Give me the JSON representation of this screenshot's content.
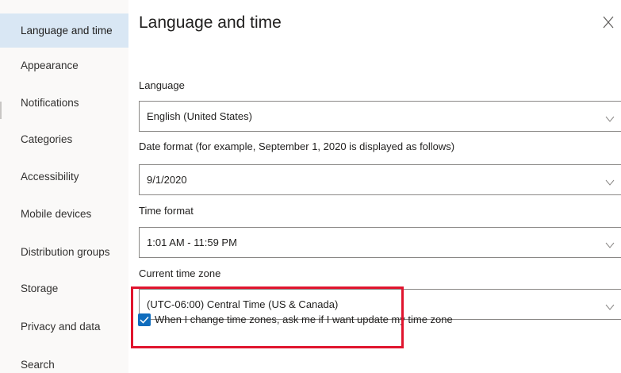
{
  "sidebar": {
    "items": [
      {
        "label": "Language and time",
        "active": true
      },
      {
        "label": "Appearance",
        "active": false
      },
      {
        "label": "Notifications",
        "active": false
      },
      {
        "label": "Categories",
        "active": false
      },
      {
        "label": "Accessibility",
        "active": false
      },
      {
        "label": "Mobile devices",
        "active": false
      },
      {
        "label": "Distribution groups",
        "active": false
      },
      {
        "label": "Storage",
        "active": false
      },
      {
        "label": "Privacy and data",
        "active": false
      },
      {
        "label": "Search",
        "active": false
      }
    ]
  },
  "main": {
    "title": "Language and time",
    "close_icon": "close-icon",
    "language": {
      "label": "Language",
      "value": "English (United States)"
    },
    "date_format": {
      "label": "Date format (for example, September 1, 2020 is displayed as follows)",
      "value": "9/1/2020"
    },
    "time_format": {
      "label": "Time format",
      "value": "1:01 AM - 11:59 PM"
    },
    "time_zone": {
      "label": "Current time zone",
      "value": "(UTC-06:00) Central Time (US & Canada)"
    },
    "ask_on_change": {
      "label": "When I change time zones, ask me if I want update my time zone",
      "checked": true
    }
  },
  "colors": {
    "active_nav_bg": "#d9e7f4",
    "checkbox_accent": "#0f6cbd",
    "highlight_border": "#e0152e"
  }
}
